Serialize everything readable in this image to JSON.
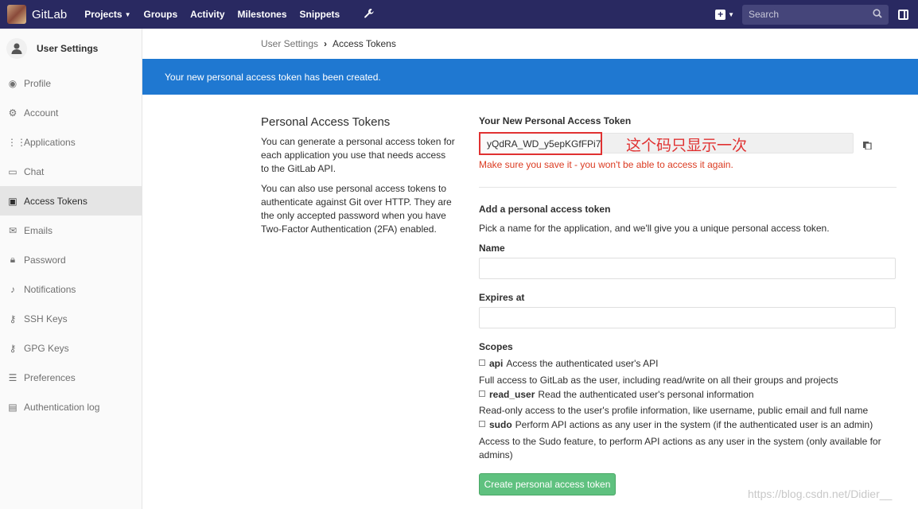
{
  "navbar": {
    "brand": "GitLab",
    "links": [
      "Projects",
      "Groups",
      "Activity",
      "Milestones",
      "Snippets"
    ],
    "search_placeholder": "Search"
  },
  "sidebar": {
    "title": "User Settings",
    "items": [
      {
        "label": "Profile",
        "icon": "profile-icon"
      },
      {
        "label": "Account",
        "icon": "account-icon"
      },
      {
        "label": "Applications",
        "icon": "applications-icon"
      },
      {
        "label": "Chat",
        "icon": "chat-icon"
      },
      {
        "label": "Access Tokens",
        "icon": "access-tokens-icon",
        "active": true
      },
      {
        "label": "Emails",
        "icon": "emails-icon"
      },
      {
        "label": "Password",
        "icon": "password-icon"
      },
      {
        "label": "Notifications",
        "icon": "notifications-icon"
      },
      {
        "label": "SSH Keys",
        "icon": "ssh-keys-icon"
      },
      {
        "label": "GPG Keys",
        "icon": "gpg-keys-icon"
      },
      {
        "label": "Preferences",
        "icon": "preferences-icon"
      },
      {
        "label": "Authentication log",
        "icon": "authentication-log-icon"
      }
    ]
  },
  "breadcrumb": {
    "parent": "User Settings",
    "current": "Access Tokens"
  },
  "flash": "Your new personal access token has been created.",
  "left": {
    "title": "Personal Access Tokens",
    "p1": "You can generate a personal access token for each application you use that needs access to the GitLab API.",
    "p2": "You can also use personal access tokens to authenticate against Git over HTTP. They are the only accepted password when you have Two-Factor Authentication (2FA) enabled."
  },
  "token": {
    "label": "Your New Personal Access Token",
    "value": "yQdRA_WD_y5epKGfFPi7",
    "annotation": "这个码只显示一次",
    "warning": "Make sure you save it - you won't be able to access it again."
  },
  "form": {
    "heading": "Add a personal access token",
    "intro": "Pick a name for the application, and we'll give you a unique personal access token.",
    "name_label": "Name",
    "expires_label": "Expires at",
    "scopes_label": "Scopes",
    "scopes": [
      {
        "name": "api",
        "summary": "Access the authenticated user's API",
        "detail": "Full access to GitLab as the user, including read/write on all their groups and projects"
      },
      {
        "name": "read_user",
        "summary": "Read the authenticated user's personal information",
        "detail": "Read-only access to the user's profile information, like username, public email and full name"
      },
      {
        "name": "sudo",
        "summary": "Perform API actions as any user in the system (if the authenticated user is an admin)",
        "detail": "Access to the Sudo feature, to perform API actions as any user in the system (only available for admins)"
      }
    ],
    "submit": "Create personal access token"
  },
  "watermark": "https://blog.csdn.net/Didier__"
}
